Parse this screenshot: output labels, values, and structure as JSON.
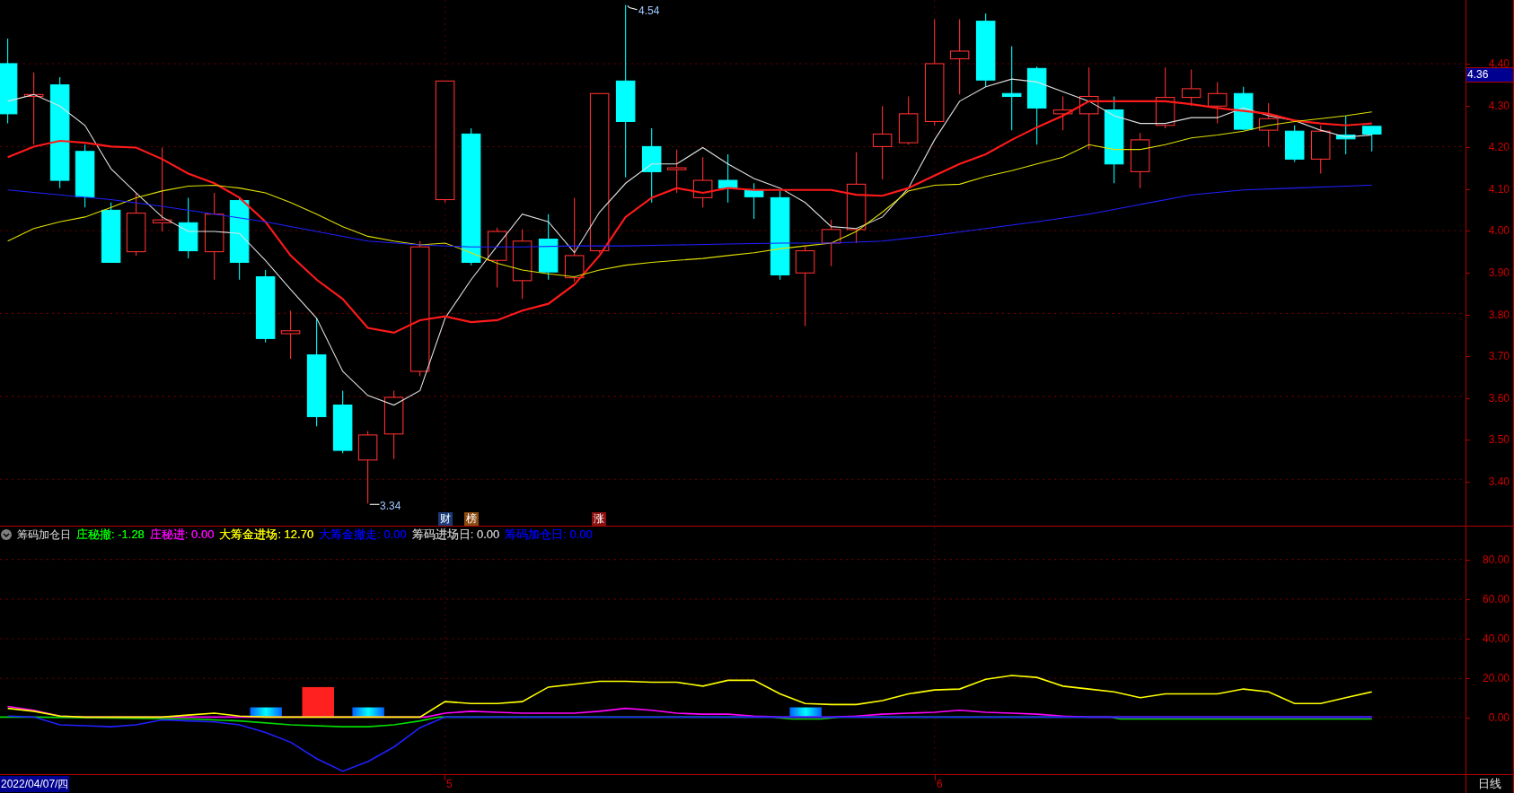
{
  "price_chart": {
    "high_marker": "4.54",
    "low_marker": "3.34",
    "event_badges": [
      {
        "label": "财",
        "color": "#1a3a78"
      },
      {
        "label": "榜",
        "color": "#8a4a10"
      },
      {
        "label": "涨",
        "color": "#8a1010"
      }
    ]
  },
  "price_axis": {
    "ticks": [
      "4.40",
      "4.30",
      "4.20",
      "4.10",
      "4.00",
      "3.90",
      "3.80",
      "3.70",
      "3.60",
      "3.50",
      "3.40"
    ],
    "current_price": "4.36"
  },
  "indicator": {
    "name": "筹码加仓日",
    "legend": [
      {
        "text": "庄秘撤: -1.28",
        "color": "#00ff00"
      },
      {
        "text": "庄秘进: 0.00",
        "color": "#ff00ff"
      },
      {
        "text": "大筹金进场: 12.70",
        "color": "#ffff00"
      },
      {
        "text": "大筹金撤走: 0.00",
        "color": "#0000ff"
      },
      {
        "text": "筹码进场日: 0.00",
        "color": "#c0c0c0"
      },
      {
        "text": "筹码加仓日: 0.00",
        "color": "#0000ff"
      }
    ],
    "axis_ticks": [
      "80.00",
      "60.00",
      "40.00",
      "20.00",
      "0.00"
    ]
  },
  "time_axis": {
    "cursor_date": "2022/04/07/四",
    "months": [
      "5",
      "6"
    ],
    "period": "日线"
  }
}
